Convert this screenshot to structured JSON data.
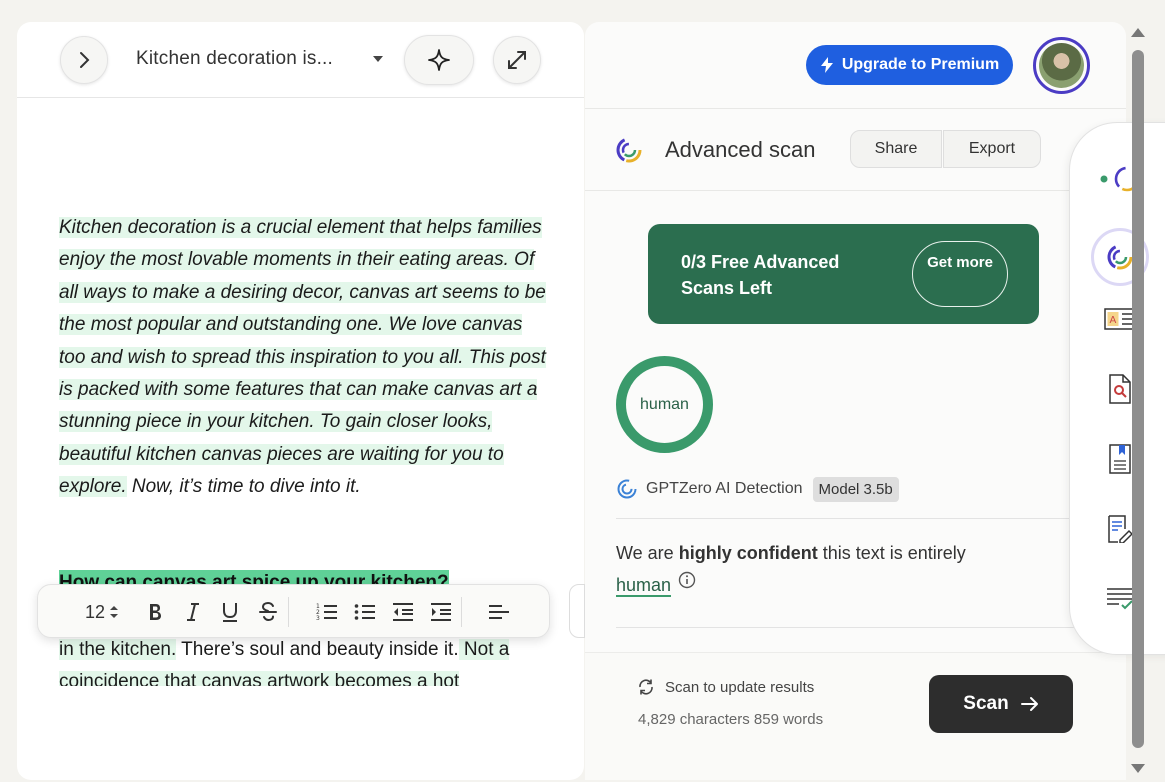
{
  "editor": {
    "doc_title": "Kitchen decoration is...",
    "paragraph1": [
      {
        "text": "Kitchen decoration is a crucial element that helps families enjoy the most lovable moments in their eating areas.",
        "highlighted": true
      },
      {
        "text": " Of all ways to make a desiring decor, canvas art seems to be the most popular and outstanding one.",
        "highlighted": true
      },
      {
        "text": " We love canvas too and wish to spread this inspiration to you all.",
        "highlighted": true
      },
      {
        "text": " This post is packed with some features that can make canvas art a stunning piece in your kitchen.",
        "highlighted": true
      },
      {
        "text": " To gain closer looks, beautiful kitchen canvas pieces are waiting for you to explore.",
        "highlighted": true
      },
      {
        "text": " Now, it’s time to dive into it.",
        "highlighted": false
      }
    ],
    "heading": "How can canvas art spice up your kitchen?",
    "paragraph2": [
      {
        "text": "in the kitchen.",
        "highlighted": true
      },
      {
        "text": " There’s soul and beauty inside it.",
        "highlighted": false
      },
      {
        "text": " Not a coincidence that canvas artwork becomes a hot",
        "highlighted": true
      }
    ]
  },
  "toolbar": {
    "font_size": "12"
  },
  "scan": {
    "upgrade_label": "Upgrade to Premium",
    "title": "Advanced scan",
    "share_label": "Share",
    "export_label": "Export",
    "promo_text": "0/3 Free Advanced Scans Left",
    "promo_button": "Get more",
    "result_ring_label": "human",
    "detector_name": "GPTZero AI Detection",
    "model_badge": "Model 3.5b",
    "confidence_prefix": "We are ",
    "confidence_strong": "highly confident",
    "confidence_suffix": " this text is entirely ",
    "confidence_result": "human",
    "update_text": "Scan to update results",
    "counts_text": "4,829 characters 859 words",
    "scan_button": "Scan"
  },
  "colors": {
    "accent_blue": "#1f5fe0",
    "promo_green": "#2b6e4f",
    "human_green": "#3a9a6b",
    "highlight_light": "#e3f7ea",
    "highlight_strong": "#5fd197"
  }
}
